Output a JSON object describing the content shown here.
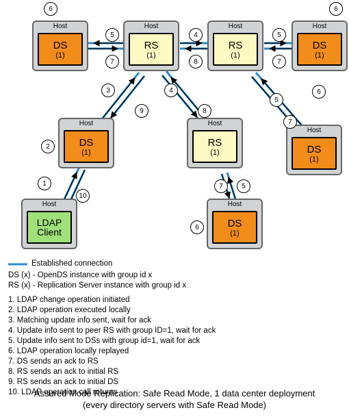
{
  "labels": {
    "host": "Host",
    "ds": "DS",
    "rs": "RS",
    "group1": "(1)",
    "ldap1": "LDAP",
    "ldap2": "Client"
  },
  "nums": {
    "1": "1",
    "2": "2",
    "3": "3",
    "4": "4",
    "5": "5",
    "6": "6",
    "7": "7",
    "8": "8",
    "9": "9",
    "10": "10"
  },
  "legend": {
    "conn": "Established connection",
    "ds": "DS (x) - OpenDS instance with group id x",
    "rs": "RS (x) - Replication Server instance with group id x"
  },
  "steps": [
    "1. LDAP change operation initiated",
    "2. LDAP operation executed locally",
    "3. Matching update info sent, wait for ack",
    "4. Update info sent to peer RS with group ID=1, wait for ack",
    "5. Update info sent to DSs with group id=1, wait for ack",
    "6. LDAP operation locally replayed",
    "7. DS sends an ack to RS",
    "8. RS sends an ack to initial RS",
    "9. RS sends an ack to initial DS",
    "10. LDAP operation call returns"
  ],
  "caption": [
    "Assured Mode Replication: Safe Read Mode, 1 data center deployment",
    "(every directory servers with Safe Read Mode)"
  ],
  "chart_data": {
    "type": "diagram",
    "nodes": [
      {
        "id": "ldap",
        "kind": "LDAP Client"
      },
      {
        "id": "ds-ml",
        "kind": "DS",
        "group": 1
      },
      {
        "id": "ds-tl",
        "kind": "DS",
        "group": 1
      },
      {
        "id": "ds-tr",
        "kind": "DS",
        "group": 1
      },
      {
        "id": "ds-r",
        "kind": "DS",
        "group": 1
      },
      {
        "id": "ds-b",
        "kind": "DS",
        "group": 1
      },
      {
        "id": "rs-tl",
        "kind": "RS",
        "group": 1
      },
      {
        "id": "rs-tr",
        "kind": "RS",
        "group": 1
      },
      {
        "id": "rs-m",
        "kind": "RS",
        "group": 1
      }
    ],
    "edges": [
      {
        "from": "ldap",
        "to": "ds-ml",
        "labels": [
          1,
          10
        ]
      },
      {
        "from": "ds-ml",
        "to": "ds-ml",
        "labels": [
          2
        ]
      },
      {
        "from": "ds-ml",
        "to": "rs-tl",
        "labels": [
          3,
          9
        ]
      },
      {
        "from": "rs-tl",
        "to": "ds-tl",
        "labels": [
          5,
          7
        ]
      },
      {
        "from": "ds-tl",
        "to": "ds-tl",
        "labels": [
          6
        ]
      },
      {
        "from": "rs-tl",
        "to": "rs-tr",
        "labels": [
          4,
          8
        ]
      },
      {
        "from": "rs-tr",
        "to": "ds-tr",
        "labels": [
          5,
          7
        ]
      },
      {
        "from": "ds-tr",
        "to": "ds-tr",
        "labels": [
          6
        ]
      },
      {
        "from": "rs-tl",
        "to": "rs-m",
        "labels": [
          4,
          8
        ]
      },
      {
        "from": "rs-tr",
        "to": "ds-r",
        "labels": [
          5,
          6,
          7
        ]
      },
      {
        "from": "rs-m",
        "to": "ds-b",
        "labels": [
          5,
          7
        ]
      },
      {
        "from": "ds-b",
        "to": "ds-b",
        "labels": [
          6
        ]
      }
    ]
  }
}
